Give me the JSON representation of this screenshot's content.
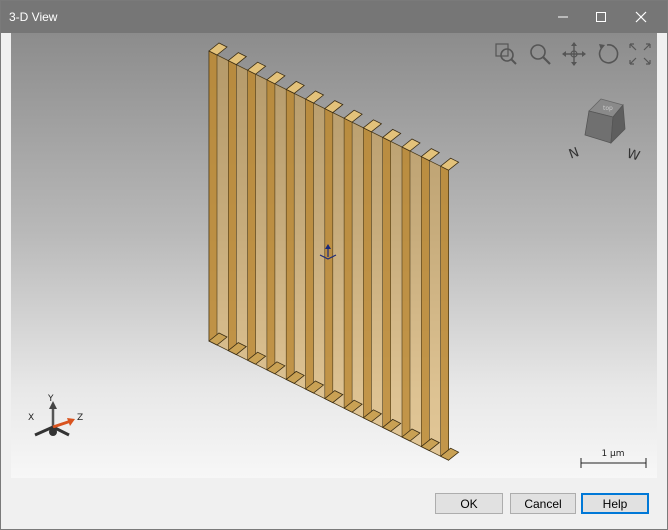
{
  "window": {
    "title": "3-D View"
  },
  "titlebar_icons": {
    "minimize": "minimize-icon",
    "maximize": "maximize-icon",
    "close": "close-icon"
  },
  "toolbar": {
    "icons": [
      "zoom-window-icon",
      "zoom-icon",
      "pan-icon",
      "rotate-icon",
      "fit-extents-icon"
    ]
  },
  "view_cube": {
    "faces": [
      "N",
      "W",
      "top"
    ]
  },
  "axis_triad": {
    "x_label": "X",
    "y_label": "Y",
    "z_label": "Z"
  },
  "scale_bar": {
    "label": "1 µm"
  },
  "buttons": {
    "ok": "OK",
    "cancel": "Cancel",
    "help": "Help"
  },
  "colors": {
    "fin": "#d4a24a",
    "fin_dark": "#b88530",
    "accent": "#0078d7",
    "titlebar": "#767676"
  }
}
